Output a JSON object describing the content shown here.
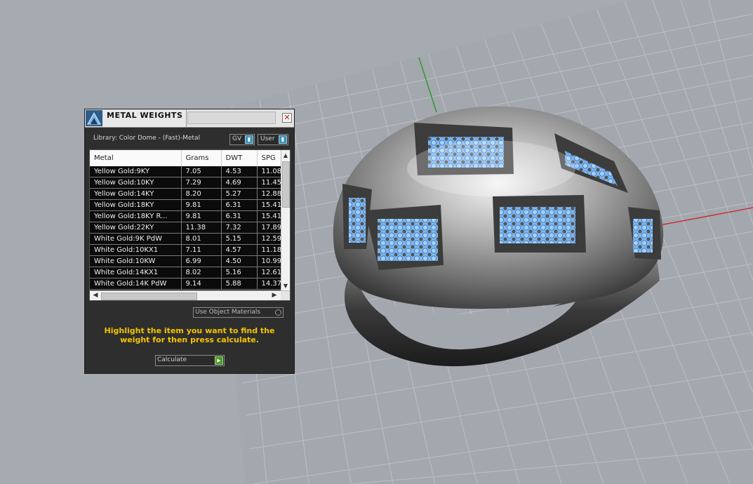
{
  "panel": {
    "title": "METAL WEIGHTS",
    "close_glyph": "✕",
    "library_label": "Library: Color Dome - (Fast)-Metal",
    "selector_gv": "GV",
    "selector_user": "User",
    "use_object_materials": "Use Object Materials",
    "hint": "Highlight the item you want to find the weight for then press calculate.",
    "calculate_label": "Calculate"
  },
  "table": {
    "headers": [
      "Metal",
      "Grams",
      "DWT",
      "SPG"
    ],
    "rows": [
      [
        "Yellow Gold:9KY",
        "7.05",
        "4.53",
        "11.08"
      ],
      [
        "Yellow Gold:10KY",
        "7.29",
        "4.69",
        "11.45"
      ],
      [
        "Yellow Gold:14KY",
        "8.20",
        "5.27",
        "12.88"
      ],
      [
        "Yellow Gold:18KY",
        "9.81",
        "6.31",
        "15.41"
      ],
      [
        "Yellow Gold:18KY R...",
        "9.81",
        "6.31",
        "15.41"
      ],
      [
        "Yellow Gold:22KY",
        "11.38",
        "7.32",
        "17.89"
      ],
      [
        "White Gold:9K PdW",
        "8.01",
        "5.15",
        "12.59"
      ],
      [
        "White Gold:10KX1",
        "7.11",
        "4.57",
        "11.18"
      ],
      [
        "White Gold:10KW",
        "6.99",
        "4.50",
        "10.99"
      ],
      [
        "White Gold:14KX1",
        "8.02",
        "5.16",
        "12.61"
      ],
      [
        "White Gold:14K PdW",
        "9.14",
        "5.88",
        "14.37"
      ]
    ]
  },
  "icons": {
    "logo": "dome-logo-icon",
    "close": "close-icon",
    "dropdown": "dropdown-arrow-icon",
    "calculate": "play-arrow-icon"
  },
  "colors": {
    "hint_text": "#f5c400",
    "gem_blue": "#6aa8ff",
    "metal": "#a9a9a9",
    "x_axis": "#c8333a",
    "y_axis": "#2e9a2e"
  }
}
